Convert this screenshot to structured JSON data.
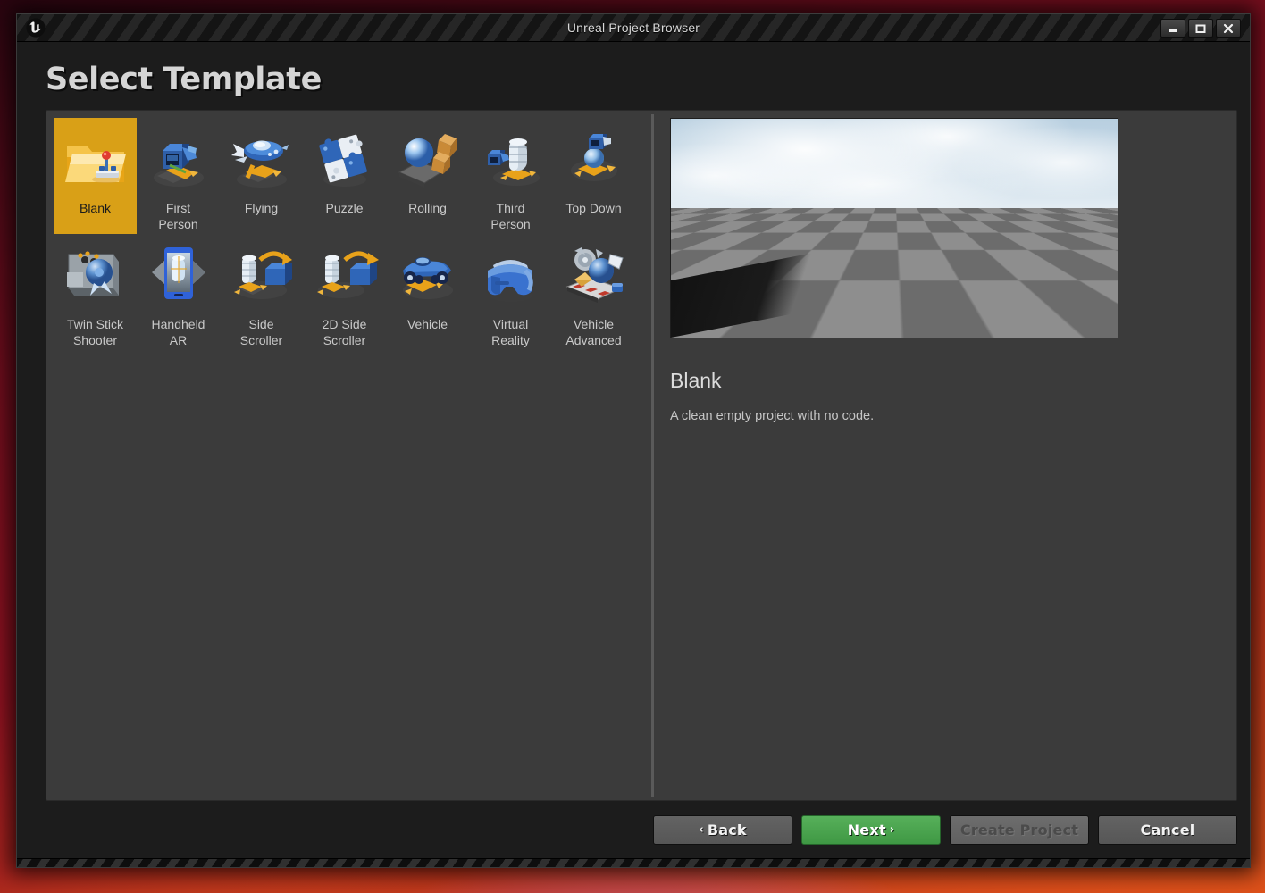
{
  "window": {
    "title": "Unreal Project Browser",
    "logo_icon": "unreal-u-logo",
    "controls": [
      {
        "name": "minimize",
        "icon": "minimize-icon"
      },
      {
        "name": "restore",
        "icon": "restore-icon"
      },
      {
        "name": "close",
        "icon": "close-icon"
      }
    ]
  },
  "page": {
    "heading": "Select Template"
  },
  "templates": {
    "selected_index": 0,
    "items": [
      {
        "label": "Blank",
        "icon": "folder-joystick-icon"
      },
      {
        "label": "First\nPerson",
        "icon": "first-person-icon"
      },
      {
        "label": "Flying",
        "icon": "flying-ship-icon"
      },
      {
        "label": "Puzzle",
        "icon": "puzzle-pieces-icon"
      },
      {
        "label": "Rolling",
        "icon": "rolling-ball-icon"
      },
      {
        "label": "Third\nPerson",
        "icon": "third-person-icon"
      },
      {
        "label": "Top Down",
        "icon": "top-down-icon"
      },
      {
        "label": "Twin Stick\nShooter",
        "icon": "twin-stick-shooter-icon"
      },
      {
        "label": "Handheld\nAR",
        "icon": "handheld-ar-icon"
      },
      {
        "label": "Side\nScroller",
        "icon": "side-scroller-icon"
      },
      {
        "label": "2D Side\nScroller",
        "icon": "2d-side-scroller-icon"
      },
      {
        "label": "Vehicle",
        "icon": "vehicle-icon"
      },
      {
        "label": "Virtual\nReality",
        "icon": "virtual-reality-icon"
      },
      {
        "label": "Vehicle\nAdvanced",
        "icon": "vehicle-advanced-icon"
      }
    ]
  },
  "preview": {
    "image_alt": "blank-level-preview",
    "title": "Blank",
    "description": "A clean empty project with no code."
  },
  "footer": {
    "buttons": [
      {
        "name": "back",
        "label": "Back",
        "style": "grey",
        "chevron": "‹",
        "chevron_side": "left",
        "disabled": false
      },
      {
        "name": "next",
        "label": "Next",
        "style": "green",
        "chevron": "›",
        "chevron_side": "right",
        "disabled": false
      },
      {
        "name": "create-project",
        "label": "Create Project",
        "style": "disabled",
        "chevron": "",
        "chevron_side": "none",
        "disabled": true
      },
      {
        "name": "cancel",
        "label": "Cancel",
        "style": "grey",
        "chevron": "",
        "chevron_side": "none",
        "disabled": false
      }
    ]
  },
  "colors": {
    "selection": "#d9a017",
    "accent_green": "#4ca84e",
    "panel_bg": "#3b3b3b",
    "window_bg": "#1c1c1c"
  }
}
